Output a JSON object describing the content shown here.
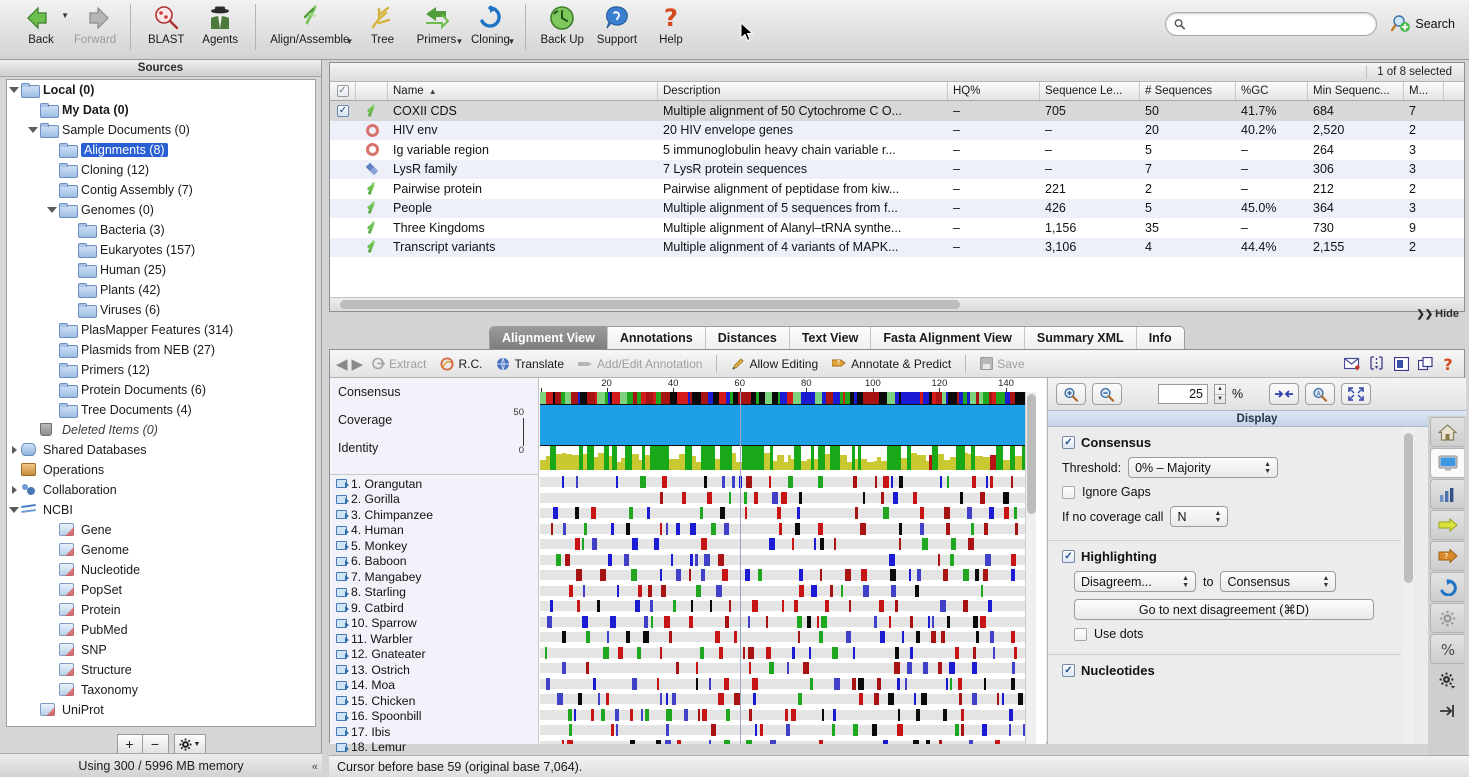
{
  "toolbar": {
    "items": [
      {
        "label": "Back",
        "icon": "back-arrow-icon",
        "dim": false,
        "caret": true
      },
      {
        "label": "Forward",
        "icon": "forward-arrow-icon",
        "dim": true,
        "caret": false
      },
      {
        "label": "BLAST",
        "icon": "blast-icon",
        "dim": false,
        "caret": false
      },
      {
        "label": "Agents",
        "icon": "agents-icon",
        "dim": false,
        "caret": false
      },
      {
        "label": "Align/Assemble",
        "icon": "align-assemble-icon",
        "dim": false,
        "caret": true
      },
      {
        "label": "Tree",
        "icon": "tree-icon",
        "dim": false,
        "caret": false
      },
      {
        "label": "Primers",
        "icon": "primers-icon",
        "dim": false,
        "caret": true
      },
      {
        "label": "Cloning",
        "icon": "cloning-icon",
        "dim": false,
        "caret": true
      },
      {
        "label": "Back Up",
        "icon": "backup-icon",
        "dim": false,
        "caret": false
      },
      {
        "label": "Support",
        "icon": "support-icon",
        "dim": false,
        "caret": false
      },
      {
        "label": "Help",
        "icon": "help-icon",
        "dim": false,
        "caret": false
      }
    ],
    "search_placeholder": "",
    "search_value": "",
    "search_button_label": "Search"
  },
  "sidebar": {
    "header": "Sources",
    "items": [
      {
        "label": "Local (0)",
        "indent": 0,
        "twisty": "open",
        "icon": "folder-icon",
        "bold": true,
        "selected": false
      },
      {
        "label": "My Data (0)",
        "indent": 1,
        "twisty": "none",
        "icon": "folder-icon",
        "bold": true,
        "selected": false
      },
      {
        "label": "Sample Documents (0)",
        "indent": 1,
        "twisty": "open",
        "icon": "folder-icon",
        "bold": false,
        "selected": false
      },
      {
        "label": "Alignments (8)",
        "indent": 2,
        "twisty": "none",
        "icon": "folder-icon",
        "bold": false,
        "selected": true
      },
      {
        "label": "Cloning (12)",
        "indent": 2,
        "twisty": "none",
        "icon": "folder-icon",
        "bold": false,
        "selected": false
      },
      {
        "label": "Contig Assembly (7)",
        "indent": 2,
        "twisty": "none",
        "icon": "folder-icon",
        "bold": false,
        "selected": false
      },
      {
        "label": "Genomes (0)",
        "indent": 2,
        "twisty": "open",
        "icon": "folder-icon",
        "bold": false,
        "selected": false
      },
      {
        "label": "Bacteria (3)",
        "indent": 3,
        "twisty": "none",
        "icon": "folder-icon",
        "bold": false,
        "selected": false
      },
      {
        "label": "Eukaryotes (157)",
        "indent": 3,
        "twisty": "none",
        "icon": "folder-icon",
        "bold": false,
        "selected": false
      },
      {
        "label": "Human (25)",
        "indent": 3,
        "twisty": "none",
        "icon": "folder-icon",
        "bold": false,
        "selected": false
      },
      {
        "label": "Plants (42)",
        "indent": 3,
        "twisty": "none",
        "icon": "folder-icon",
        "bold": false,
        "selected": false
      },
      {
        "label": "Viruses (6)",
        "indent": 3,
        "twisty": "none",
        "icon": "folder-icon",
        "bold": false,
        "selected": false
      },
      {
        "label": "PlasMapper Features (314)",
        "indent": 2,
        "twisty": "none",
        "icon": "folder-icon",
        "bold": false,
        "selected": false
      },
      {
        "label": "Plasmids from NEB (27)",
        "indent": 2,
        "twisty": "none",
        "icon": "folder-icon",
        "bold": false,
        "selected": false
      },
      {
        "label": "Primers (12)",
        "indent": 2,
        "twisty": "none",
        "icon": "folder-icon",
        "bold": false,
        "selected": false
      },
      {
        "label": "Protein Documents (6)",
        "indent": 2,
        "twisty": "none",
        "icon": "folder-icon",
        "bold": false,
        "selected": false
      },
      {
        "label": "Tree Documents (4)",
        "indent": 2,
        "twisty": "none",
        "icon": "folder-icon",
        "bold": false,
        "selected": false
      },
      {
        "label": "Deleted Items (0)",
        "indent": 1,
        "twisty": "none",
        "icon": "trash-icon",
        "italic": true,
        "selected": false
      },
      {
        "label": "Shared Databases",
        "indent": 0,
        "twisty": "closed",
        "icon": "database-icon",
        "bold": false,
        "selected": false
      },
      {
        "label": "Operations",
        "indent": 0,
        "twisty": "none",
        "icon": "operations-icon",
        "bold": false,
        "selected": false
      },
      {
        "label": "Collaboration",
        "indent": 0,
        "twisty": "closed",
        "icon": "collaboration-icon",
        "bold": false,
        "selected": false
      },
      {
        "label": "NCBI",
        "indent": 0,
        "twisty": "open",
        "icon": "ncbi-icon",
        "bold": false,
        "selected": false
      },
      {
        "label": "Gene",
        "indent": 2,
        "twisty": "none",
        "icon": "page-icon",
        "bold": false,
        "selected": false
      },
      {
        "label": "Genome",
        "indent": 2,
        "twisty": "none",
        "icon": "page-icon",
        "bold": false,
        "selected": false
      },
      {
        "label": "Nucleotide",
        "indent": 2,
        "twisty": "none",
        "icon": "page-icon",
        "bold": false,
        "selected": false
      },
      {
        "label": "PopSet",
        "indent": 2,
        "twisty": "none",
        "icon": "page-icon",
        "bold": false,
        "selected": false
      },
      {
        "label": "Protein",
        "indent": 2,
        "twisty": "none",
        "icon": "page-icon",
        "bold": false,
        "selected": false
      },
      {
        "label": "PubMed",
        "indent": 2,
        "twisty": "none",
        "icon": "page-icon",
        "bold": false,
        "selected": false
      },
      {
        "label": "SNP",
        "indent": 2,
        "twisty": "none",
        "icon": "page-icon",
        "bold": false,
        "selected": false
      },
      {
        "label": "Structure",
        "indent": 2,
        "twisty": "none",
        "icon": "page-icon",
        "bold": false,
        "selected": false
      },
      {
        "label": "Taxonomy",
        "indent": 2,
        "twisty": "none",
        "icon": "page-icon",
        "bold": false,
        "selected": false
      },
      {
        "label": "UniProt",
        "indent": 1,
        "twisty": "none",
        "icon": "page-icon",
        "bold": false,
        "selected": false
      }
    ],
    "add_button": "+",
    "remove_button": "−",
    "gear_button": "gear-icon",
    "memory_status": "Using 300 / 5996 MB memory",
    "collapse_label": "«"
  },
  "documents": {
    "selection_status": "1 of 8 selected",
    "hide_label": "Hide",
    "columns": [
      "Name",
      "Description",
      "HQ%",
      "Sequence Le...",
      "# Sequences",
      "%GC",
      "Min Sequenc...",
      "M..."
    ],
    "sort_column": "Name",
    "sort_direction": "asc",
    "rows": [
      {
        "checked": true,
        "icon": "alignment-icon",
        "name": "COXII CDS",
        "description": "Multiple alignment of 50 Cytochrome C O...",
        "hq": "–",
        "length": "705",
        "seqs": "50",
        "gc": "41.7%",
        "min": "684",
        "max": "7",
        "selected": true
      },
      {
        "checked": false,
        "icon": "circular-icon",
        "name": "HIV env",
        "description": "20 HIV envelope genes",
        "hq": "–",
        "length": "–",
        "seqs": "20",
        "gc": "40.2%",
        "min": "2,520",
        "max": "2",
        "selected": false
      },
      {
        "checked": false,
        "icon": "circular-icon",
        "name": "Ig variable region",
        "description": "5 immunoglobulin heavy chain variable r...",
        "hq": "–",
        "length": "–",
        "seqs": "5",
        "gc": "–",
        "min": "264",
        "max": "3",
        "selected": false
      },
      {
        "checked": false,
        "icon": "protein-icon",
        "name": "LysR family",
        "description": "7 LysR protein sequences",
        "hq": "–",
        "length": "–",
        "seqs": "7",
        "gc": "–",
        "min": "306",
        "max": "3",
        "selected": false
      },
      {
        "checked": false,
        "icon": "alignment-icon",
        "name": "Pairwise protein",
        "description": "Pairwise alignment of peptidase from kiw...",
        "hq": "–",
        "length": "221",
        "seqs": "2",
        "gc": "–",
        "min": "212",
        "max": "2",
        "selected": false
      },
      {
        "checked": false,
        "icon": "alignment-icon",
        "name": "People",
        "description": "Multiple alignment of 5 sequences from f...",
        "hq": "–",
        "length": "426",
        "seqs": "5",
        "gc": "45.0%",
        "min": "364",
        "max": "3",
        "selected": false
      },
      {
        "checked": false,
        "icon": "alignment-icon",
        "name": "Three Kingdoms",
        "description": "Multiple alignment of Alanyl–tRNA synthe...",
        "hq": "–",
        "length": "1,156",
        "seqs": "35",
        "gc": "–",
        "min": "730",
        "max": "9",
        "selected": false
      },
      {
        "checked": false,
        "icon": "alignment-icon",
        "name": "Transcript variants",
        "description": "Multiple alignment of 4 variants of MAPK...",
        "hq": "–",
        "length": "3,106",
        "seqs": "4",
        "gc": "44.4%",
        "min": "2,155",
        "max": "2",
        "selected": false
      }
    ]
  },
  "view": {
    "tabs": [
      {
        "label": "Alignment View",
        "active": true
      },
      {
        "label": "Annotations",
        "active": false
      },
      {
        "label": "Distances",
        "active": false
      },
      {
        "label": "Text View",
        "active": false
      },
      {
        "label": "Fasta Alignment View",
        "active": false
      },
      {
        "label": "Summary XML",
        "active": false
      },
      {
        "label": "Info",
        "active": false
      }
    ],
    "toolbar": {
      "back_icon": "back-arrow-icon",
      "forward_icon": "forward-arrow-icon",
      "extract": "Extract",
      "rc": "R.C.",
      "translate": "Translate",
      "add_edit_annotation": "Add/Edit Annotation",
      "allow_editing": "Allow Editing",
      "annotate_predict": "Annotate & Predict",
      "save": "Save",
      "right_icons": [
        "envelope-icon",
        "split-view-icon",
        "dock-panel-icon",
        "new-window-icon",
        "help-icon"
      ]
    }
  },
  "alignment": {
    "header_rows": [
      "Consensus",
      "Coverage",
      "Identity"
    ],
    "coverage_scale_max": "50",
    "coverage_scale_min": "0",
    "ruler_ticks": [
      "20",
      "40",
      "60",
      "80",
      "100",
      "120",
      "140"
    ],
    "sequences": [
      "1. Orangutan",
      "2. Gorilla",
      "3. Chimpanzee",
      "4. Human",
      "5. Monkey",
      "6. Baboon",
      "7. Mangabey",
      "8. Starling",
      "9. Catbird",
      "10. Sparrow",
      "11. Warbler",
      "12. Gnateater",
      "13. Ostrich",
      "14. Moa",
      "15. Chicken",
      "16. Spoonbill",
      "17. Ibis",
      "18. Lemur"
    ]
  },
  "display_panel": {
    "zoom_in_icon": "zoom-in-icon",
    "zoom_out_icon": "zoom-out-icon",
    "zoom_value": "25",
    "zoom_unit": "%",
    "fit_width_icon": "fit-width-icon",
    "find_icon": "find-icon",
    "fullscreen_icon": "fullscreen-icon",
    "title": "Display",
    "consensus": {
      "label": "Consensus",
      "checked": true,
      "threshold_label": "Threshold:",
      "threshold_value": "0% – Majority",
      "ignore_gaps_label": "Ignore Gaps",
      "ignore_gaps_checked": false,
      "no_coverage_label": "If no coverage call",
      "no_coverage_value": "N"
    },
    "highlighting": {
      "label": "Highlighting",
      "checked": true,
      "mode_value": "Disagreem...",
      "to_label": "to",
      "reference_value": "Consensus",
      "next_disagreement_button": "Go to next disagreement (⌘D)",
      "use_dots_label": "Use dots",
      "use_dots_checked": false
    },
    "nucleotides": {
      "label": "Nucleotides",
      "checked": true
    },
    "side_tabs": [
      {
        "icon": "home-icon",
        "active": false
      },
      {
        "icon": "display-monitor-icon",
        "active": true
      },
      {
        "icon": "statistics-chart-icon",
        "active": false
      },
      {
        "icon": "yellow-arrow-icon",
        "active": false
      },
      {
        "icon": "orange-help-arrow-icon",
        "active": false
      },
      {
        "icon": "refresh-circle-icon",
        "active": false
      },
      {
        "icon": "settings-gear-icon",
        "active": false
      },
      {
        "icon": "percent-icon",
        "active": false
      },
      {
        "icon": "advanced-gear-icon",
        "active": false
      },
      {
        "icon": "collapse-panel-icon",
        "active": false
      }
    ]
  },
  "status": {
    "message": "Cursor before base 59 (original base 7,064)."
  },
  "colors": {
    "accent": "#2a5fd4",
    "coverage": "#1f9fe8",
    "identity_green": "#18a818",
    "identity_olive": "#c8c832",
    "selected_row": "#d8d8d8",
    "alt_row": "#eef0f9"
  }
}
